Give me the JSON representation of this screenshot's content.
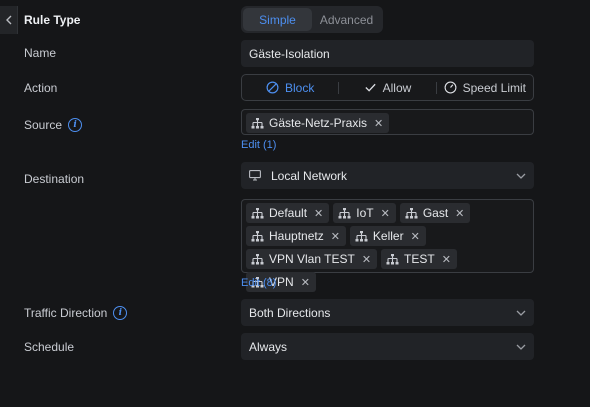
{
  "rule_type": {
    "label": "Rule Type",
    "options": [
      "Simple",
      "Advanced"
    ],
    "selected": "Simple"
  },
  "name": {
    "label": "Name",
    "value": "Gäste-Isolation"
  },
  "action": {
    "label": "Action",
    "options": [
      {
        "label": "Block",
        "icon": "block-icon"
      },
      {
        "label": "Allow",
        "icon": "check-icon"
      },
      {
        "label": "Speed Limit",
        "icon": "speedometer-icon"
      }
    ],
    "selected": "Block"
  },
  "source": {
    "label": "Source",
    "chips": [
      "Gäste-Netz-Praxis"
    ],
    "edit_label": "Edit (1)"
  },
  "destination": {
    "label": "Destination",
    "dropdown_value": "Local Network",
    "dropdown_icon": "monitor-icon",
    "chips": [
      "Default",
      "IoT",
      "Gast",
      "Hauptnetz",
      "Keller",
      "VPN Vlan TEST",
      "TEST",
      "VPN"
    ],
    "edit_label": "Edit (8)"
  },
  "traffic_direction": {
    "label": "Traffic Direction",
    "value": "Both Directions"
  },
  "schedule": {
    "label": "Schedule",
    "value": "Always"
  },
  "colors": {
    "background": "#151618",
    "accent": "#4d8ff0",
    "field": "#212327",
    "chip": "#2a2c30"
  }
}
